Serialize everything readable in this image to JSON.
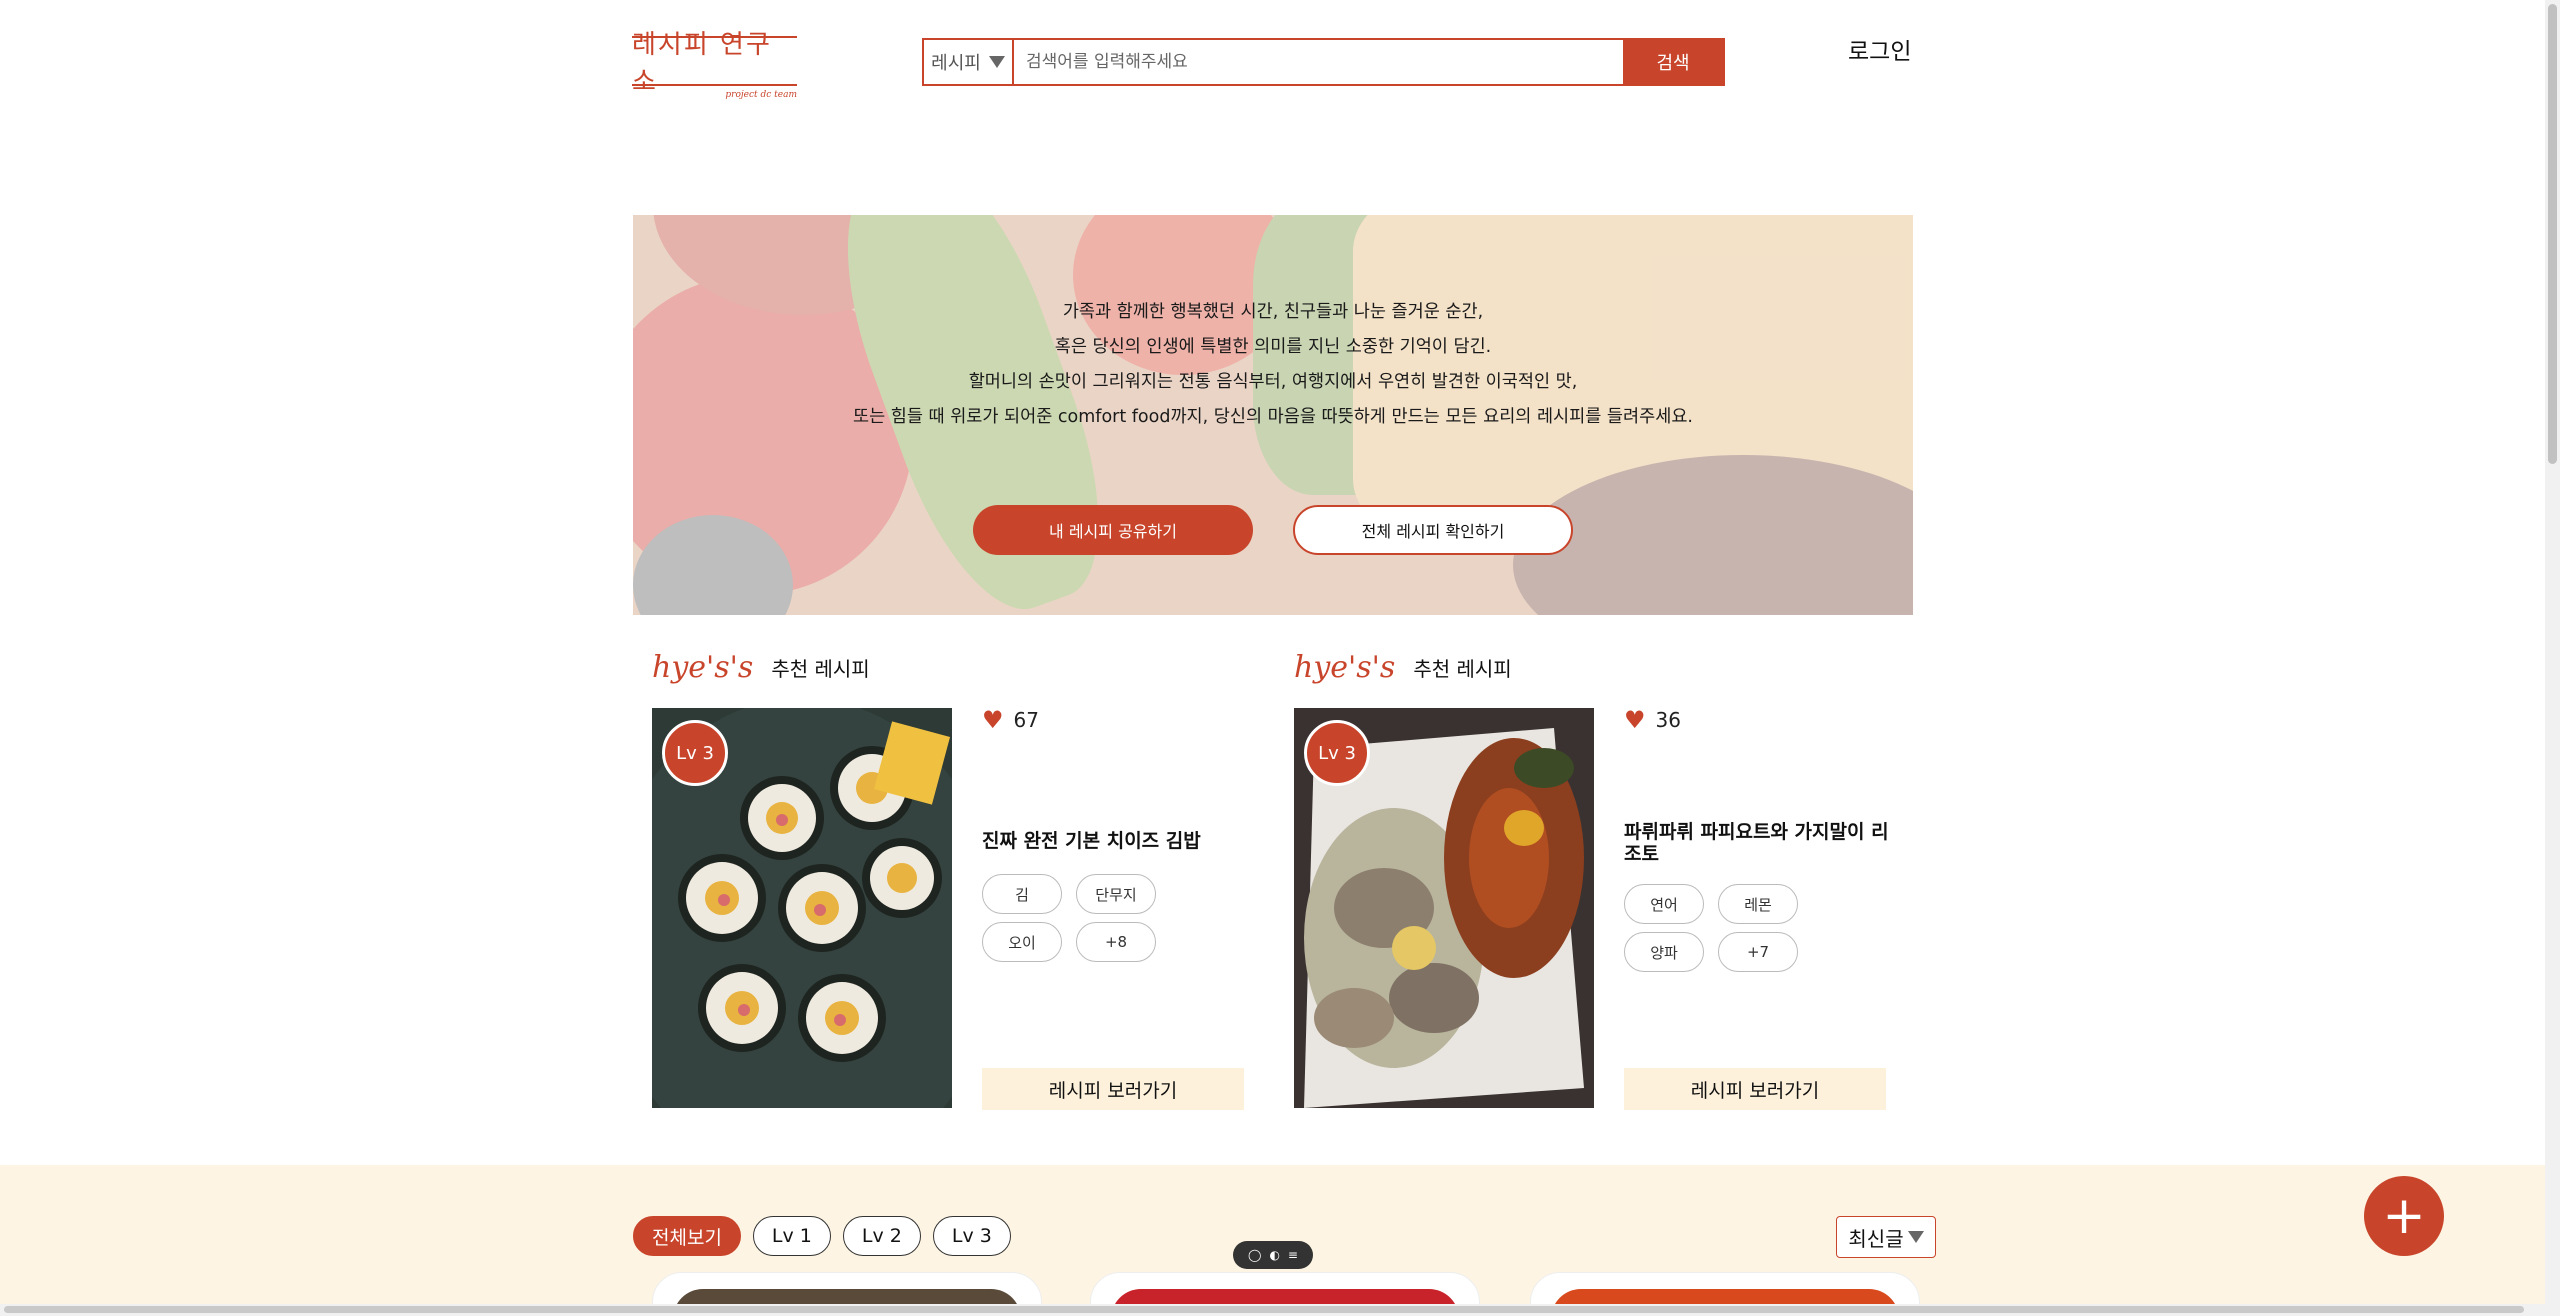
{
  "header": {
    "logo_text": "레시피 연구소",
    "logo_sub": "project dc team",
    "search_select": "레시피",
    "search_placeholder": "검색어를 입력해주세요",
    "search_button": "검색",
    "login": "로그인"
  },
  "hero": {
    "lines": [
      "가족과 함께한 행복했던 시간, 친구들과 나눈 즐거운 순간,",
      "혹은 당신의 인생에 특별한 의미를 지닌 소중한 기억이 담긴.",
      "할머니의 손맛이 그리워지는 전통 음식부터, 여행지에서 우연히 발견한 이국적인 맛,",
      "또는 힘들 때 위로가 되어준 comfort food까지, 당신의 마음을 따뜻하게 만드는 모든 요리의 레시피를 들려주세요."
    ],
    "primary_button": "내 레시피 공유하기",
    "secondary_button": "전체 레시피 확인하기"
  },
  "recommended": [
    {
      "brand": "hye's's",
      "title": "추천 레시피",
      "level": "Lv 3",
      "likes": "67",
      "name": "진짜 완전 기본 치이즈 김밥",
      "tags": [
        "김",
        "단무지",
        "오이",
        "+8"
      ],
      "button": "레시피 보러가기"
    },
    {
      "brand": "hye's's",
      "title": "추천 레시피",
      "level": "Lv 3",
      "likes": "36",
      "name": "파뤼파뤼 파피요트와 가지말이 리조토",
      "tags": [
        "연어",
        "레몬",
        "양파",
        "+7"
      ],
      "button": "레시피 보러가기"
    }
  ],
  "filters": [
    "전체보기",
    "Lv 1",
    "Lv 2",
    "Lv 3"
  ],
  "sort": "최신글",
  "fab": "+",
  "colors": {
    "accent": "#c8452b",
    "cream": "#fdf4e3",
    "button_bg": "#fdf1dc"
  },
  "icons": {
    "heart": "heart-icon",
    "add": "plus-icon",
    "dropdown": "chevron-down-icon"
  }
}
